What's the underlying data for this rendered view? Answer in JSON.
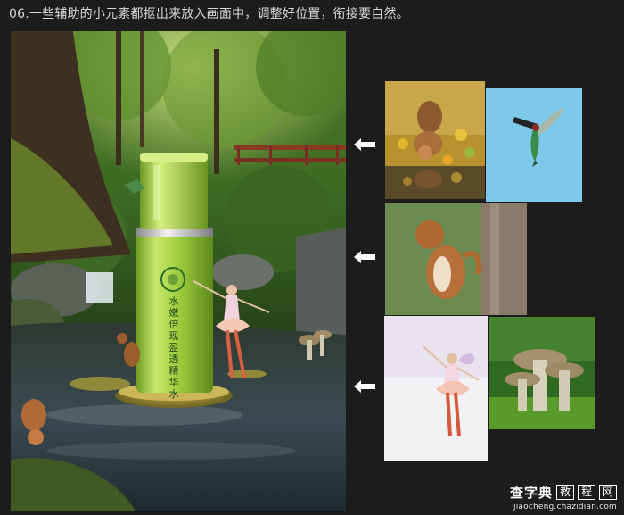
{
  "header": {
    "step_text": "06.一些辅助的小元素都抠出来放入画面中，调整好位置，衔接要自然。"
  },
  "composite": {
    "bottle_label": "水嫩倍现盈透精华水"
  },
  "watermark": {
    "brand": "查字典",
    "box_chars": [
      "教",
      "程",
      "网"
    ],
    "url": "jiaocheng.chazidian.com"
  },
  "colors": {
    "background": "#1c1c1c",
    "arrow": "#ffffff",
    "bottle_green": "#9acb3c"
  },
  "icons": [
    "left-arrow-icon",
    "left-arrow-icon",
    "left-arrow-icon"
  ]
}
